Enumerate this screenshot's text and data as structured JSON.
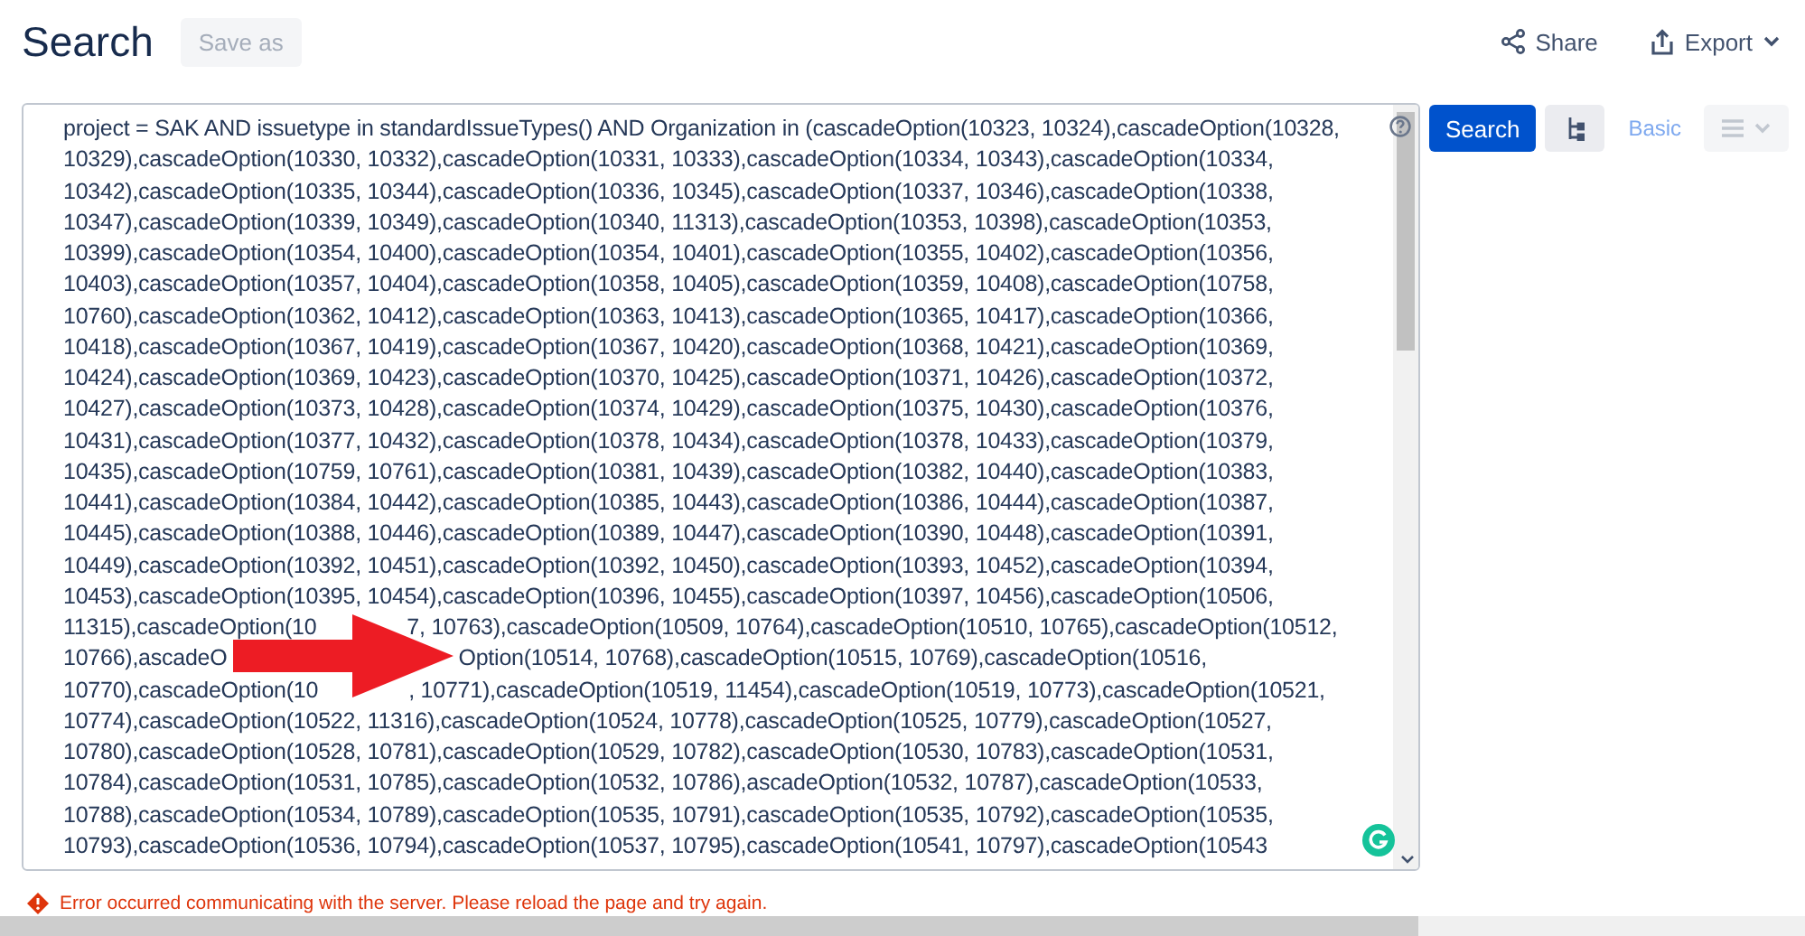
{
  "header": {
    "title": "Search",
    "save_as": {
      "label": "Save as",
      "disabled": true
    },
    "actions": [
      {
        "kind": "share",
        "label": "Share"
      },
      {
        "kind": "export",
        "label": "Export"
      }
    ]
  },
  "query": {
    "lines": [
      [
        "project = SAK AND issuetype in standardIssueTypes() AND Organization in (cascadeOption(10323, 10324),cascadeOption(10328,"
      ],
      [
        "10329),cascadeOption(10330, 10332),cascadeOption(10331, 10333),cascadeOption(10334, 10343),cascadeOption(10334,"
      ],
      [
        "10342),cascadeOption(10335, 10344),cascadeOption(10336, 10345),cascadeOption(10337, 10346),cascadeOption(10338,"
      ],
      [
        "10347),cascadeOption(10339, 10349),cascadeOption(10340, 11313),cascadeOption(10353, 10398),cascadeOption(10353,"
      ],
      [
        "10399),cascadeOption(10354, 10400),cascadeOption(10354, 10401),cascadeOption(10355, 10402),cascadeOption(10356,"
      ],
      [
        "10403),cascadeOption(10357, 10404),cascadeOption(10358, 10405),cascadeOption(10359, 10408),cascadeOption(10758,"
      ],
      [
        "10760),cascadeOption(10362, 10412),cascadeOption(10363, 10413),cascadeOption(10365, 10417),cascadeOption(10366,"
      ],
      [
        "10418),cascadeOption(10367, 10419),cascadeOption(10367, 10420),cascadeOption(10368, 10421),cascadeOption(10369,"
      ],
      [
        "10424),cascadeOption(10369, 10423),cascadeOption(10370, 10425),cascadeOption(10371, 10426),cascadeOption(10372,"
      ],
      [
        "10427),cascadeOption(10373, 10428),cascadeOption(10374, 10429),cascadeOption(10375, 10430),cascadeOption(10376,"
      ],
      [
        "10431),cascadeOption(10377, 10432),cascadeOption(10378, 10434),cascadeOption(10378, 10433),cascadeOption(10379,"
      ],
      [
        "10435),cascadeOption(10759, 10761),cascadeOption(10381, 10439),cascadeOption(10382, 10440),cascadeOption(10383,"
      ],
      [
        "10441),cascadeOption(10384, 10442),cascadeOption(10385, 10443),cascadeOption(10386, 10444),cascadeOption(10387,"
      ],
      [
        "10445),cascadeOption(10388, 10446),cascadeOption(10389, 10447),cascadeOption(10390, 10448),cascadeOption(10391,"
      ],
      [
        "10449),cascadeOption(10392, 10451),cascadeOption(10392, 10450),cascadeOption(10393, 10452),cascadeOption(10394,"
      ],
      [
        "10453),cascadeOption(10395, 10454),cascadeOption(10396, 10455),cascadeOption(10397, 10456),cascadeOption(10506,"
      ],
      [
        "11315),cascadeOption(10",
        "7, 10763),cascadeOption(10509, 10764),cascadeOption(10510, 10765),cascadeOption(10512,"
      ],
      [
        "10766),ascadeO",
        "Option(10514, 10768),cascadeOption(10515, 10769),cascadeOption(10516,"
      ],
      [
        "10770),cascadeOption(10",
        ", 10771),cascadeOption(10519, 11454),cascadeOption(10519, 10773),cascadeOption(10521,"
      ],
      [
        "10774),cascadeOption(10522, 11316),cascadeOption(10524, 10778),cascadeOption(10525, 10779),cascadeOption(10527,"
      ],
      [
        "10780),cascadeOption(10528, 10781),cascadeOption(10529, 10782),cascadeOption(10530, 10783),cascadeOption(10531,"
      ],
      [
        "10784),cascadeOption(10531, 10785),cascadeOption(10532, 10786),ascadeOption(10532, 10787),cascadeOption(10533,"
      ],
      [
        "10788),cascadeOption(10534, 10789),cascadeOption(10535, 10791),cascadeOption(10535, 10792),cascadeOption(10535,"
      ],
      [
        "10793),cascadeOption(10536, 10794),cascadeOption(10537, 10795),cascadeOption(10541, 10797),cascadeOption(10543"
      ]
    ],
    "annotation": {
      "kind": "arrow"
    }
  },
  "controls": {
    "search_button": "Search",
    "basic_link": "Basic",
    "menu_button": {
      "disabled": true
    }
  },
  "error": "Error occurred communicating with the server. Please reload the page and try again."
}
